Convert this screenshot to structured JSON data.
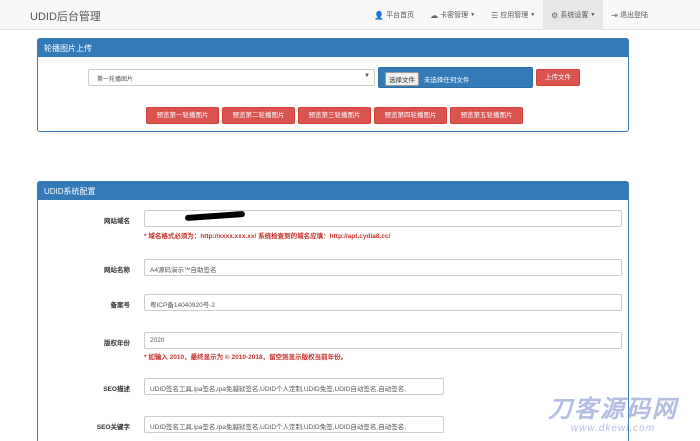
{
  "navbar": {
    "brand": "UDID后台管理",
    "items": [
      {
        "label": "平台首页",
        "icon": "user-icon",
        "glyph": "👤",
        "dropdown": false
      },
      {
        "label": "卡密管理",
        "icon": "cloud-icon",
        "glyph": "☁",
        "dropdown": true
      },
      {
        "label": "应用管理",
        "icon": "list-icon",
        "glyph": "☰",
        "dropdown": true
      },
      {
        "label": "系统设置",
        "icon": "gear-icon",
        "glyph": "⚙",
        "dropdown": true
      },
      {
        "label": "退出登陆",
        "icon": "logout-icon",
        "glyph": "⇥",
        "dropdown": false
      }
    ]
  },
  "upload": {
    "title": "轮播图片上传",
    "select_value": "第一轮播图片",
    "file_button": "选择文件",
    "file_status": "未选择任何文件",
    "upload_button": "上传文件",
    "previews": [
      "预览第一轮播图片",
      "预览第二轮播图片",
      "预览第三轮播图片",
      "预览第四轮播图片",
      "预览第五轮播图片"
    ]
  },
  "config": {
    "title": "UDID系统配置",
    "domain_label": "网站域名",
    "domain_hint": "* 域名格式必须为：http://xxxx.xxx.xx/ 系统检查到的域名应填：http://apt.cydia8.cc/",
    "name_label": "网站名称",
    "name_value": "A4源码演示™自助签名",
    "icp_label": "备案号",
    "icp_value": "粤ICP备14040920号-2",
    "year_label": "版权年份",
    "year_value": "2020",
    "year_hint": "* 如输入 2010，最终显示为 © 2010-2018，留空则显示版权当前年份。",
    "seo_desc_label": "SEO描述",
    "seo_desc_value": "UDID签名工具,ipa签名,ipa免越狱签名,UDID个人定制,UDID免签,UDID自动签名,自动签名,",
    "seo_kw_label": "SEO关键字",
    "seo_kw_value": "UDID签名工具,ipa签名,ipa免越狱签名,UDID个人定制,UDID免签,UDID自动签名,自动签名,"
  },
  "watermark": {
    "main": "刀客源码网",
    "sub": "www.dkewl.com"
  },
  "colors": {
    "primary": "#337ab7",
    "danger": "#d9534f",
    "hint": "#c9302c"
  }
}
